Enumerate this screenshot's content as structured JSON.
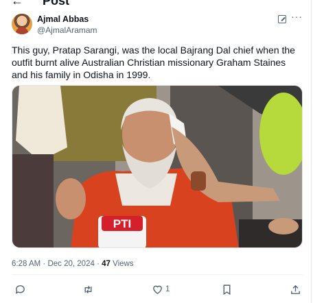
{
  "topbar": {
    "back_icon": "arrow-left-icon",
    "title": "Post"
  },
  "author": {
    "name": "Ajmal Abbas",
    "handle": "@AjmalAramam"
  },
  "header_icons": {
    "grok": "grok-icon",
    "more": "more-horizontal-icon"
  },
  "tweet": {
    "text": "This guy, Pratap Sarangi, was the local Bajrang Dal chief when the outfit burnt alive Australian Christian missionary Graham Staines and his family in Odisha in 1999."
  },
  "media": {
    "mic_logo": "PTI"
  },
  "meta": {
    "time": "6:28 AM",
    "separator": "·",
    "date": "Dec 20, 2024",
    "views_count": "47",
    "views_label": "Views"
  },
  "actions": {
    "reply_icon": "reply-icon",
    "repost_icon": "repost-icon",
    "like_icon": "heart-icon",
    "like_count": "1",
    "bookmark_icon": "bookmark-icon",
    "share_icon": "share-icon"
  },
  "colors": {
    "text": "#0f1419",
    "secondary": "#536471",
    "divider": "#eff3f4"
  }
}
